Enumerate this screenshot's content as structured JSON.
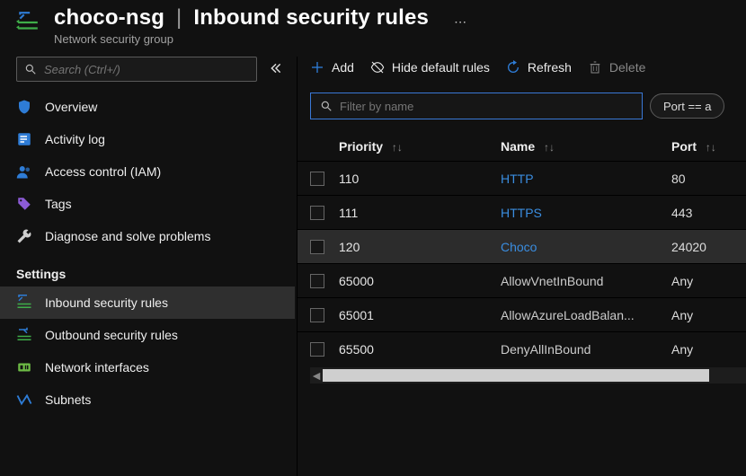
{
  "header": {
    "resource": "choco-nsg",
    "separator": "|",
    "page": "Inbound security rules",
    "subtitle": "Network security group",
    "more": "⋯"
  },
  "sidebar": {
    "search_placeholder": "Search (Ctrl+/)",
    "section_top": [
      {
        "icon": "shield-icon",
        "label": "Overview",
        "color": "#2e7cd6"
      },
      {
        "icon": "log-icon",
        "label": "Activity log",
        "color": "#2e7cd6"
      },
      {
        "icon": "people-icon",
        "label": "Access control (IAM)",
        "color": "#2e7cd6"
      },
      {
        "icon": "tag-icon",
        "label": "Tags",
        "color": "#7d4bd1"
      },
      {
        "icon": "wrench-icon",
        "label": "Diagnose and solve problems",
        "color": "#bfbfbf"
      }
    ],
    "settings_label": "Settings",
    "section_settings": [
      {
        "icon": "inbound-icon",
        "label": "Inbound security rules",
        "active": true
      },
      {
        "icon": "outbound-icon",
        "label": "Outbound security rules",
        "active": false
      },
      {
        "icon": "nic-icon",
        "label": "Network interfaces",
        "active": false
      },
      {
        "icon": "subnet-icon",
        "label": "Subnets",
        "active": false
      }
    ]
  },
  "toolbar": {
    "add": "Add",
    "hide": "Hide default rules",
    "refresh": "Refresh",
    "delete": "Delete"
  },
  "filter": {
    "placeholder": "Filter by name",
    "chip": "Port == a"
  },
  "table": {
    "columns": {
      "priority": "Priority",
      "name": "Name",
      "port": "Port"
    },
    "sort_glyph": "↑↓",
    "rows": [
      {
        "priority": "110",
        "name": "HTTP",
        "port": "80",
        "kind": "custom"
      },
      {
        "priority": "111",
        "name": "HTTPS",
        "port": "443",
        "kind": "custom"
      },
      {
        "priority": "120",
        "name": "Choco",
        "port": "24020",
        "kind": "custom",
        "hover": true
      },
      {
        "priority": "65000",
        "name": "AllowVnetInBound",
        "port": "Any",
        "kind": "default"
      },
      {
        "priority": "65001",
        "name": "AllowAzureLoadBalan...",
        "port": "Any",
        "kind": "default"
      },
      {
        "priority": "65500",
        "name": "DenyAllInBound",
        "port": "Any",
        "kind": "default"
      }
    ]
  }
}
